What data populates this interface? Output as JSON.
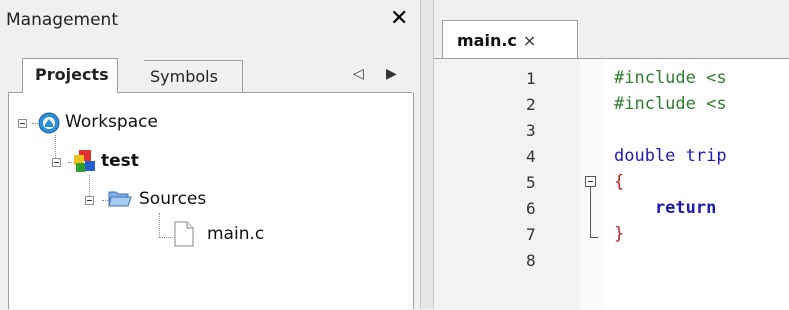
{
  "management": {
    "title": "Management",
    "close": "✕",
    "tabs": [
      {
        "label": "Projects",
        "active": true
      },
      {
        "label": "Symbols",
        "active": false
      }
    ],
    "arrows": {
      "left": "◁",
      "right": "▶"
    },
    "tree": [
      {
        "label": "Workspace",
        "icon": "workspace-icon"
      },
      {
        "label": "test",
        "icon": "project-icon"
      },
      {
        "label": "Sources",
        "icon": "folder-open-icon"
      },
      {
        "label": "main.c",
        "icon": "file-icon"
      }
    ]
  },
  "editor": {
    "tab": {
      "label": "main.c",
      "close": "×"
    },
    "line_numbers": [
      "1",
      "2",
      "3",
      "4",
      "5",
      "6",
      "7",
      "8"
    ],
    "lines": [
      {
        "text": "#include <s",
        "style": "preprocessor"
      },
      {
        "text": "#include <s",
        "style": "preprocessor"
      },
      {
        "text": "",
        "style": "plain"
      },
      {
        "text": "double trip",
        "style": "declaration"
      },
      {
        "text": "{",
        "style": "brace"
      },
      {
        "text": "    return",
        "style": "keyword"
      },
      {
        "text": "}",
        "style": "brace"
      },
      {
        "text": "",
        "style": "plain"
      }
    ]
  },
  "colors": {
    "preprocessor": "#2e7d2e",
    "keyword": "#1c1cb4",
    "brace": "#c02020"
  }
}
